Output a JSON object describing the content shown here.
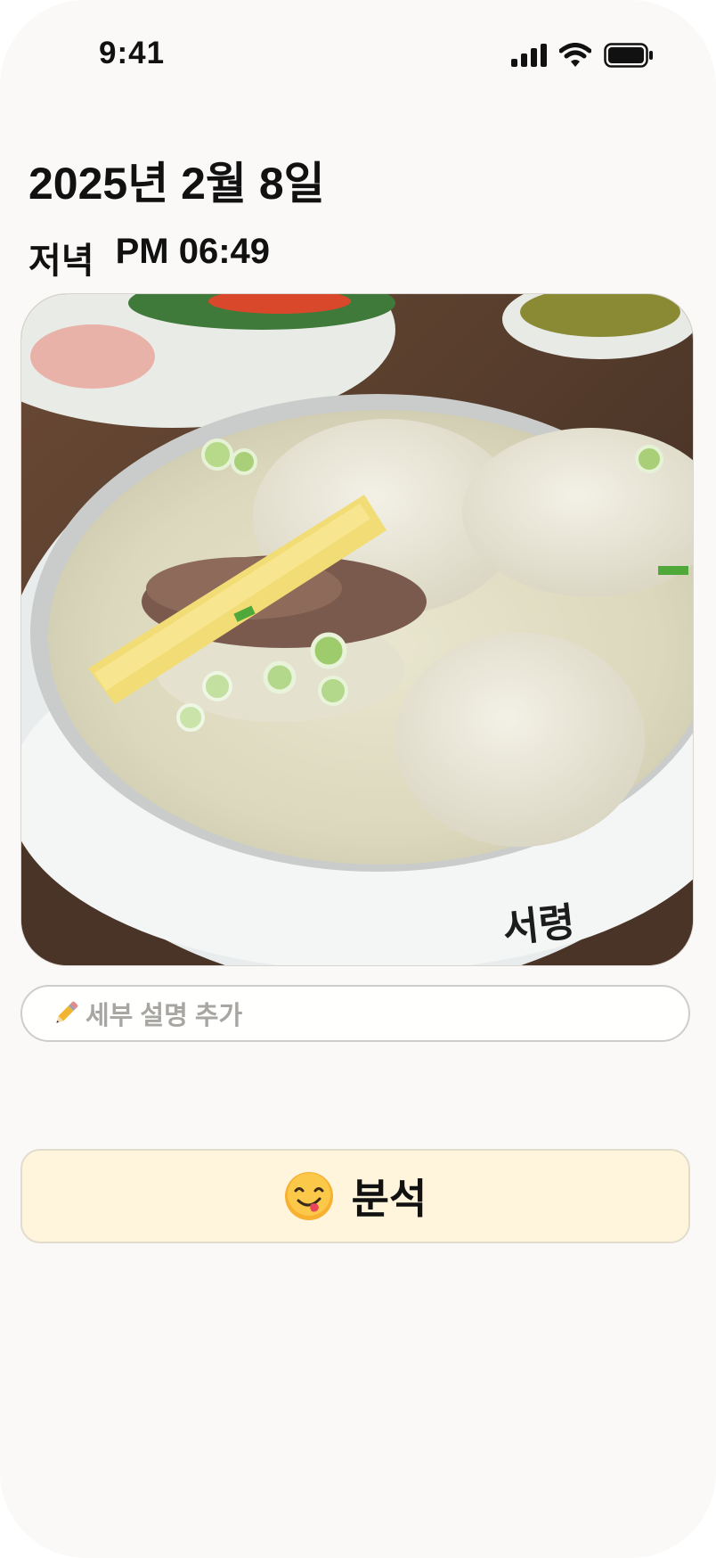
{
  "status_bar": {
    "time": "9:41"
  },
  "header": {
    "date": "2025년 2월 8일"
  },
  "meal": {
    "label": "저녁",
    "time": "PM 06:49"
  },
  "photo": {
    "watermark": "서령"
  },
  "description": {
    "placeholder": "세부 설명 추가",
    "icon": "pencil-icon"
  },
  "analyze": {
    "label": "분석",
    "icon": "face-savoring-food-icon"
  },
  "colors": {
    "background": "#faf9f7",
    "button_bg": "#fff4dc",
    "placeholder_text": "#a7a6a3"
  }
}
